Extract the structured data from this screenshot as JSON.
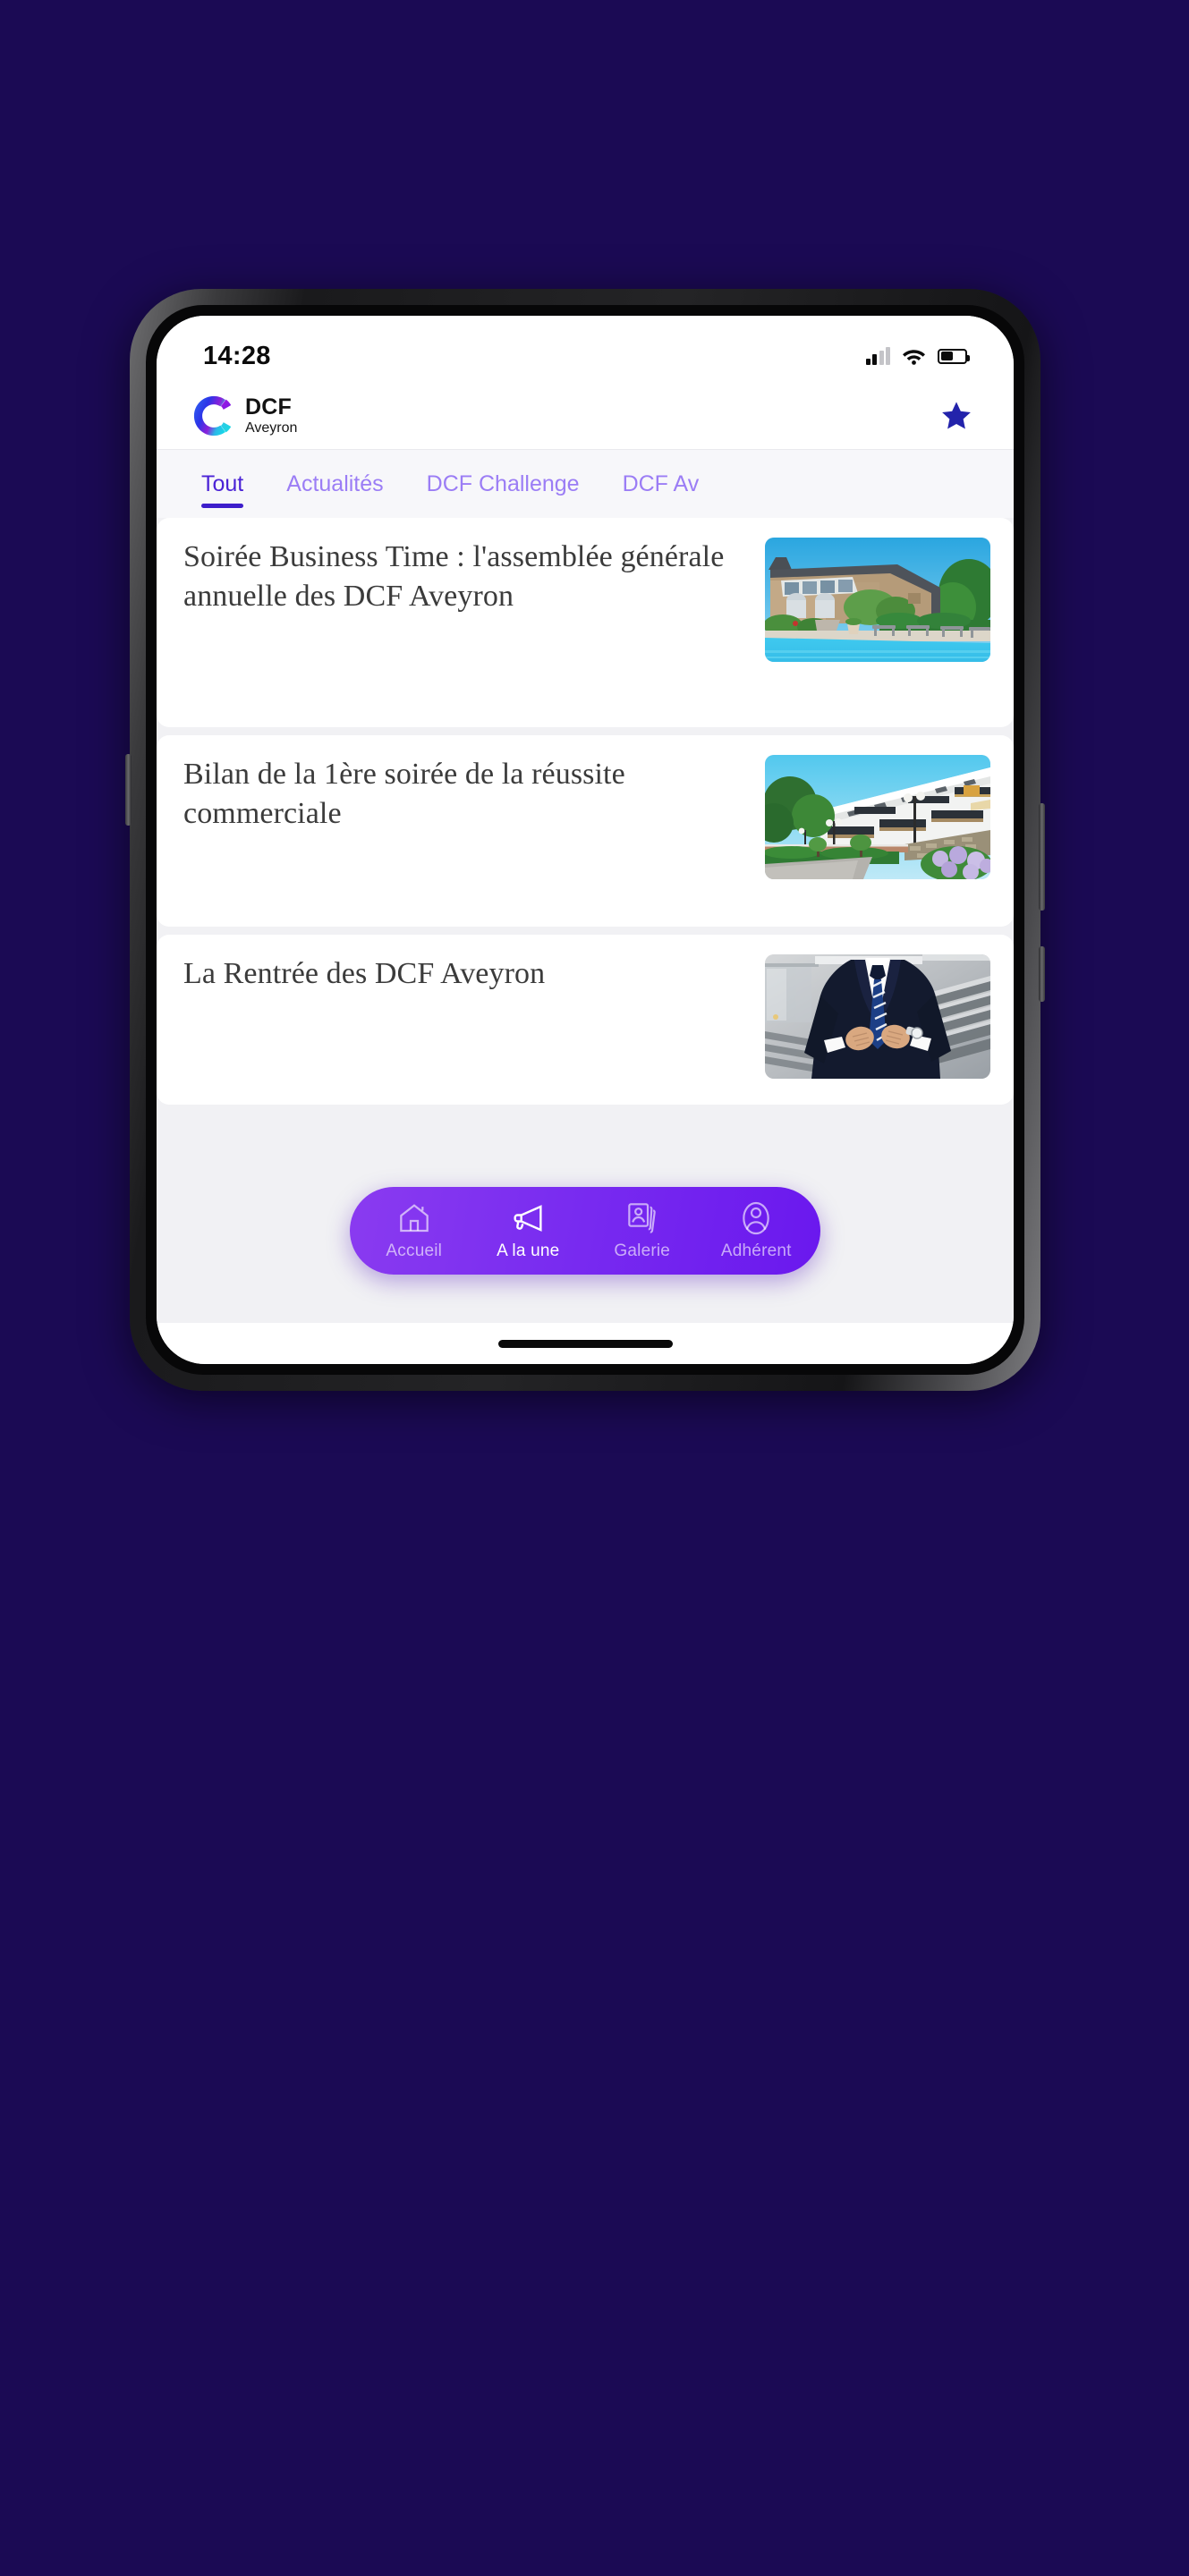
{
  "theme": {
    "page_background": "#1b0a54",
    "accent_purple": "#7a2df0",
    "tab_active": "#4b23d6",
    "tab_inactive": "#9b7df5",
    "star_color": "#2323ab"
  },
  "status_bar": {
    "time": "14:28",
    "signal_icon": "cellular-signal-icon",
    "signal_bars_filled": 2,
    "signal_bars_total": 4,
    "wifi_icon": "wifi-icon",
    "battery_icon": "battery-icon",
    "battery_percent": 50
  },
  "app_bar": {
    "logo_icon": "dcf-logo-icon",
    "brand_line1": "DCF",
    "brand_line2": "Aveyron",
    "favorite_icon": "star-icon"
  },
  "tabs": [
    {
      "label": "Tout",
      "active": true
    },
    {
      "label": "Actualités",
      "active": false
    },
    {
      "label": "DCF Challenge",
      "active": false
    },
    {
      "label": "DCF Av",
      "active": false
    }
  ],
  "articles": [
    {
      "title": "Soirée Business Time : l'assemblée générale annuelle des DCF Aveyron",
      "image_alt": "stone-manor-with-swimming-pool"
    },
    {
      "title": "Bilan de la 1ère soirée de la réussite commerciale",
      "image_alt": "white-apartment-building-with-balconies"
    },
    {
      "title": "La Rentrée des DCF Aveyron",
      "image_alt": "businessman-in-suit-buttoning-jacket"
    }
  ],
  "bottom_nav": [
    {
      "label": "Accueil",
      "icon": "home-icon",
      "active": false
    },
    {
      "label": "A la une",
      "icon": "megaphone-icon",
      "active": true
    },
    {
      "label": "Galerie",
      "icon": "photos-icon",
      "active": false
    },
    {
      "label": "Adhérent",
      "icon": "person-icon",
      "active": false
    }
  ]
}
